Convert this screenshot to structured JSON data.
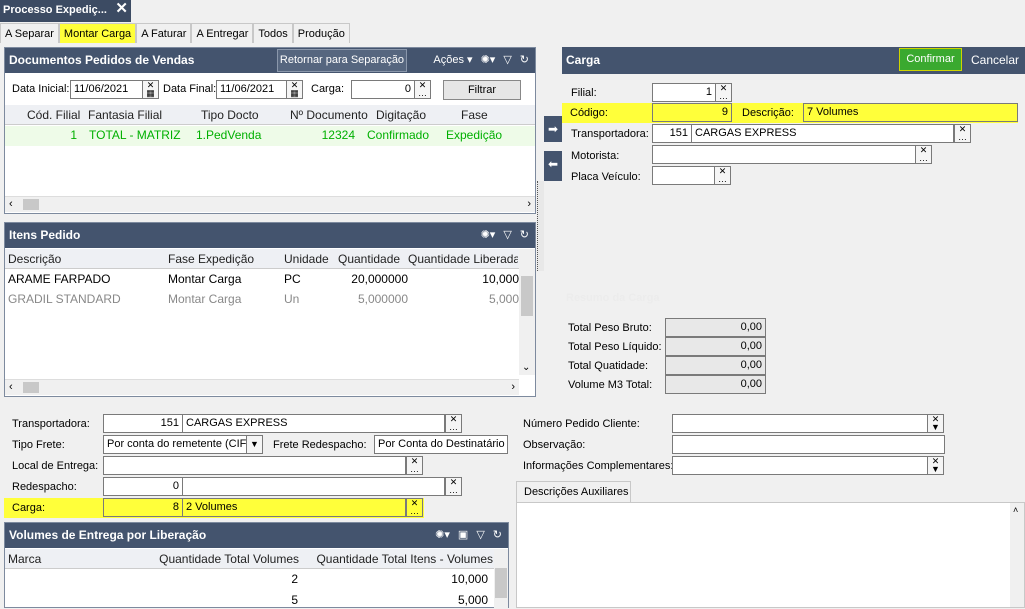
{
  "window_title": "Processo Expediç...",
  "close_glyph": "✕",
  "tabs": [
    "A Separar",
    "Montar Carga",
    "A Faturar",
    "A Entregar",
    "Todos",
    "Produção"
  ],
  "docs": {
    "title": "Documentos Pedidos de Vendas",
    "retornar": "Retornar para Separação",
    "acoes": "Ações",
    "data_inicial_label": "Data Inicial:",
    "data_inicial": "11/06/2021",
    "data_final_label": "Data Final:",
    "data_final": "11/06/2021",
    "carga_label": "Carga:",
    "carga": "0",
    "filtrar": "Filtrar",
    "columns": [
      "Cód. Filial",
      "Fantasia Filial",
      "Tipo Docto",
      "Nº Documento",
      "Digitação",
      "Fase"
    ],
    "row": [
      "1",
      "TOTAL - MATRIZ",
      "1.PedVenda",
      "12324",
      "Confirmado",
      "Expedição"
    ]
  },
  "itens": {
    "title": "Itens Pedido",
    "columns": [
      "Descrição",
      "Fase Expedição",
      "Unidade",
      "Quantidade",
      "Quantidade Liberada"
    ],
    "rows": [
      [
        "ARAME FARPADO",
        "Montar Carga",
        "PC",
        "20,000000",
        "10,000"
      ],
      [
        "GRADIL STANDARD",
        "Montar Carga",
        "Un",
        "5,000000",
        "5,000"
      ]
    ]
  },
  "carga": {
    "title": "Carga",
    "confirmar": "Confirmar",
    "cancelar": "Cancelar",
    "filial_label": "Filial:",
    "filial": "1",
    "codigo_label": "Código:",
    "codigo": "9",
    "descricao_label": "Descrição:",
    "descricao": "7 Volumes",
    "transportadora_label": "Transportadora:",
    "transportadora_cod": "151",
    "transportadora": "CARGAS EXPRESS",
    "motorista_label": "Motorista:",
    "placa_label": "Placa Veículo:",
    "resumo_title": "Resumo da Carga",
    "peso_bruto_label": "Total Peso Bruto:",
    "peso_bruto": "0,00",
    "peso_liquido_label": "Total Peso Líquido:",
    "peso_liquido": "0,00",
    "quantidade_label": "Total Quatidade:",
    "quantidade": "0,00",
    "volume_label": "Volume M3 Total:",
    "volume": "0,00"
  },
  "bottom": {
    "transportadora_label": "Transportadora:",
    "transportadora_cod": "151",
    "transportadora": "CARGAS EXPRESS",
    "tipo_frete_label": "Tipo Frete:",
    "tipo_frete": "Por conta do remetente (CIF)",
    "frete_redespacho_label": "Frete Redespacho:",
    "frete_redespacho": "Por Conta do Destinatário",
    "local_entrega_label": "Local de Entrega:",
    "redespacho_label": "Redespacho:",
    "redespacho": "0",
    "carga_label": "Carga:",
    "carga_cod": "8",
    "carga_desc": "2 Volumes",
    "numero_pedido_label": "Número Pedido Cliente:",
    "observacao_label": "Observação:",
    "info_label": "Informações Complementares:",
    "desc_aux_tab": "Descrições Auxiliares"
  },
  "volumes": {
    "title": "Volumes de Entrega por Liberação",
    "columns": [
      "Marca",
      "Quantidade Total Volumes",
      "Quantidade Total Itens - Volumes"
    ],
    "rows": [
      [
        "",
        "2",
        "10,000"
      ],
      [
        "",
        "5",
        "5,000"
      ]
    ]
  },
  "colors": {
    "header": "#44546e",
    "highlight": "#ffff3a",
    "green": "#00b000"
  }
}
